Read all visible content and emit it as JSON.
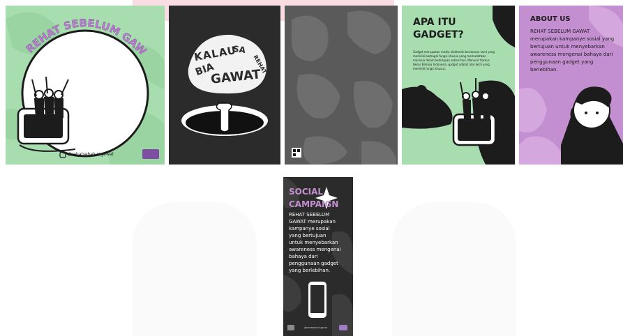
{
  "colors": {
    "green": "#a8ddb0",
    "purple": "#c48fd0",
    "dark": "#2b2b2b",
    "mid": "#4a4a4a",
    "light_purple": "#d9a5e2",
    "pink": "#f6d4dc"
  },
  "card1": {
    "arc_title": "REHAT SEBELUM GAWAT",
    "handle": "@rehatsebelumgawat",
    "instagram_icon": "instagram-icon"
  },
  "card2": {
    "lettering_line1": "KALAU",
    "lettering_line2": "GAWAT",
    "lettering_small1": "BIA",
    "lettering_small2": "SA",
    "lettering_small3": "REHAT"
  },
  "card4": {
    "title_line1": "APA ITU",
    "title_line2": "GADGET?",
    "body": "Gadget merupakan media elektronik berukuran kecil yang memiliki berbagai fungsi khusus yang memudahkan manusia dalam kehidupan sehari-hari. Menurut Kamus Besar Bahasa Indonesia, gadget adalah alat kecil yang memiliki fungsi khusus."
  },
  "card5": {
    "title": "ABOUT US",
    "body": "REHAT SEBELUM GAWAT merupakan kampanye sosial yang bertujuan untuk menyebarkan awareness mengenai bahaya dari penggunaan gadget yang berlebihan."
  },
  "card6": {
    "title_line1": "SOCIAL",
    "title_line2": "CAMPAIGN",
    "body_lines": [
      "REHAT SEBELUM",
      "GAWAT merupakan",
      "kampanye sosial",
      "yang bertujuan",
      "untuk menyebarkan",
      "awareness mengenai",
      "bahaya dari",
      "penggunaan gadget",
      "yang berlebihan."
    ],
    "footer_handle": "@rehatsebelumgawat"
  }
}
